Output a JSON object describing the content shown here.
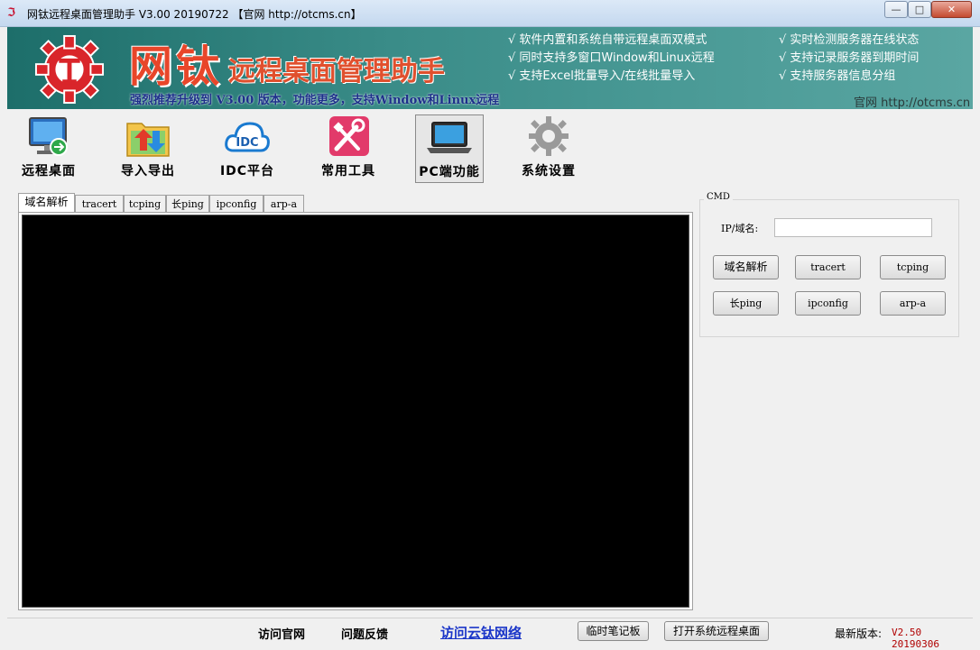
{
  "window": {
    "title": "网钛远程桌面管理助手 V3.00 20190722 【官网 http://otcms.cn】",
    "app_icon_glyph": "ℑ",
    "controls": {
      "minimize": "—",
      "maximize": "□",
      "close": "✕"
    }
  },
  "banner": {
    "brand_main": "网钛",
    "brand_sub": "远程桌面管理助手",
    "tagline": "强烈推荐升级到 V3.00 版本，功能更多，支持Window和Linux远程",
    "features_left": [
      "√ 软件内置和系统自带远程桌面双模式",
      "√ 同时支持多窗口Window和Linux远程",
      "√ 支持Excel批量导入/在线批量导入"
    ],
    "features_right": [
      "√ 实时检测服务器在线状态",
      "√ 支持记录服务器到期时间",
      "√ 支持服务器信息分组"
    ],
    "site": "官网  http://otcms.cn"
  },
  "toolbar": {
    "items": [
      {
        "label": "远程桌面",
        "icon": "remote-desktop-icon"
      },
      {
        "label": "导入导出",
        "icon": "import-export-icon"
      },
      {
        "label": "IDC平台",
        "icon": "idc-cloud-icon",
        "icon_text": "IDC"
      },
      {
        "label": "常用工具",
        "icon": "tools-icon"
      },
      {
        "label": "PC端功能",
        "icon": "laptop-icon"
      },
      {
        "label": "系统设置",
        "icon": "gear-icon"
      }
    ],
    "active": "PC端功能"
  },
  "tabs": [
    {
      "label": "域名解析",
      "selected": true
    },
    {
      "label": "tracert"
    },
    {
      "label": "tcping"
    },
    {
      "label": "长ping"
    },
    {
      "label": "ipconfig"
    },
    {
      "label": "arp-a"
    }
  ],
  "cmd_panel": {
    "group_title": "CMD",
    "ip_label": "IP/域名:",
    "ip_value": "",
    "buttons": [
      "域名解析",
      "tracert",
      "tcping",
      "长ping",
      "ipconfig",
      "arp-a"
    ]
  },
  "statusbar": {
    "visit_site": "访问官网",
    "feedback": "问题反馈",
    "cloud_link": "访问云钛网络",
    "notepad_button": "临时笔记板",
    "open_remote_button": "打开系统远程桌面",
    "latest_version_label": "最新版本:",
    "latest_version_value": "V2.50 20190306"
  },
  "colors": {
    "banner": "#3a8c88",
    "brand_red": "#e8462a",
    "tagline_blue": "#1c2f8a",
    "link_blue": "#1a35c8",
    "version_red": "#b00000"
  }
}
